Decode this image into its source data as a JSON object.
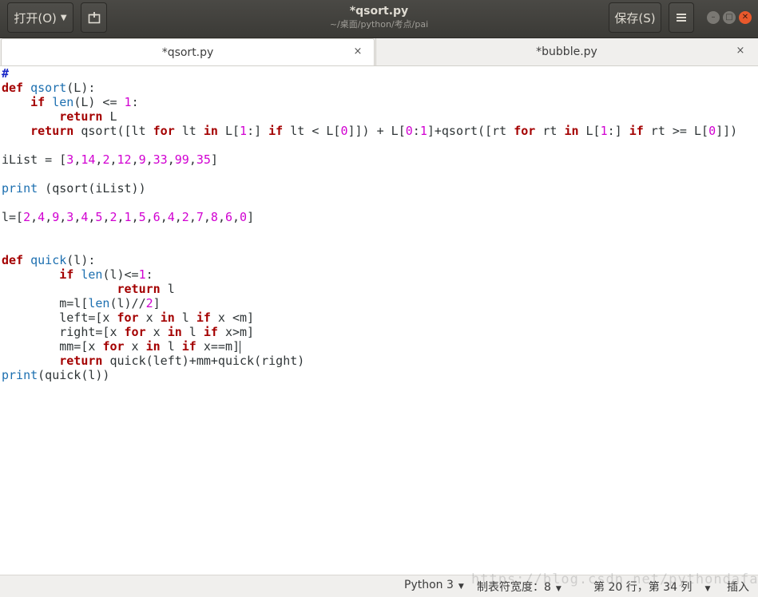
{
  "header": {
    "open_label": "打开(O)",
    "save_label": "保存(S)",
    "title": "*qsort.py",
    "subtitle": "~/桌面/python/考点/pai",
    "menu_icon": "hamburger-icon",
    "newtab_icon": "new-document-icon"
  },
  "tabs": [
    {
      "label": "*qsort.py",
      "active": true
    },
    {
      "label": "*bubble.py",
      "active": false
    }
  ],
  "code_lines": [
    "#",
    "def qsort(L):",
    "    if len(L) <= 1:",
    "        return L",
    "    return qsort([lt for lt in L[1:] if lt < L[0]]) + L[0:1]+qsort([rt for rt in L[1:] if rt >= L[0]])",
    "",
    "iList = [3,14,2,12,9,33,99,35]",
    "",
    "print (qsort(iList))",
    "",
    "l=[2,4,9,3,4,5,2,1,5,6,4,2,7,8,6,0]",
    "",
    "",
    "def quick(l):",
    "        if len(l)<=1:",
    "                return l",
    "        m=l[len(l)//2]",
    "        left=[x for x in l if x <m]",
    "        right=[x for x in l if x>m]",
    "        mm=[x for x in l if x==m]",
    "        return quick(left)+mm+quick(right)",
    "print(quick(l))"
  ],
  "cursor": {
    "line": 20,
    "column": 34
  },
  "statusbar": {
    "language": "Python 3",
    "tab_width": "制表符宽度：8",
    "position": "第 20 行，第 34 列",
    "mode": "插入"
  },
  "watermark": "https://blog.csdn.net/pythondafahao",
  "colors": {
    "keyword": "#a40000",
    "builtin": "#1c6fb0",
    "number": "#d100d1",
    "comment": "#1a28c7",
    "headerbar": "#3c3b37",
    "close_button": "#e9592c"
  }
}
